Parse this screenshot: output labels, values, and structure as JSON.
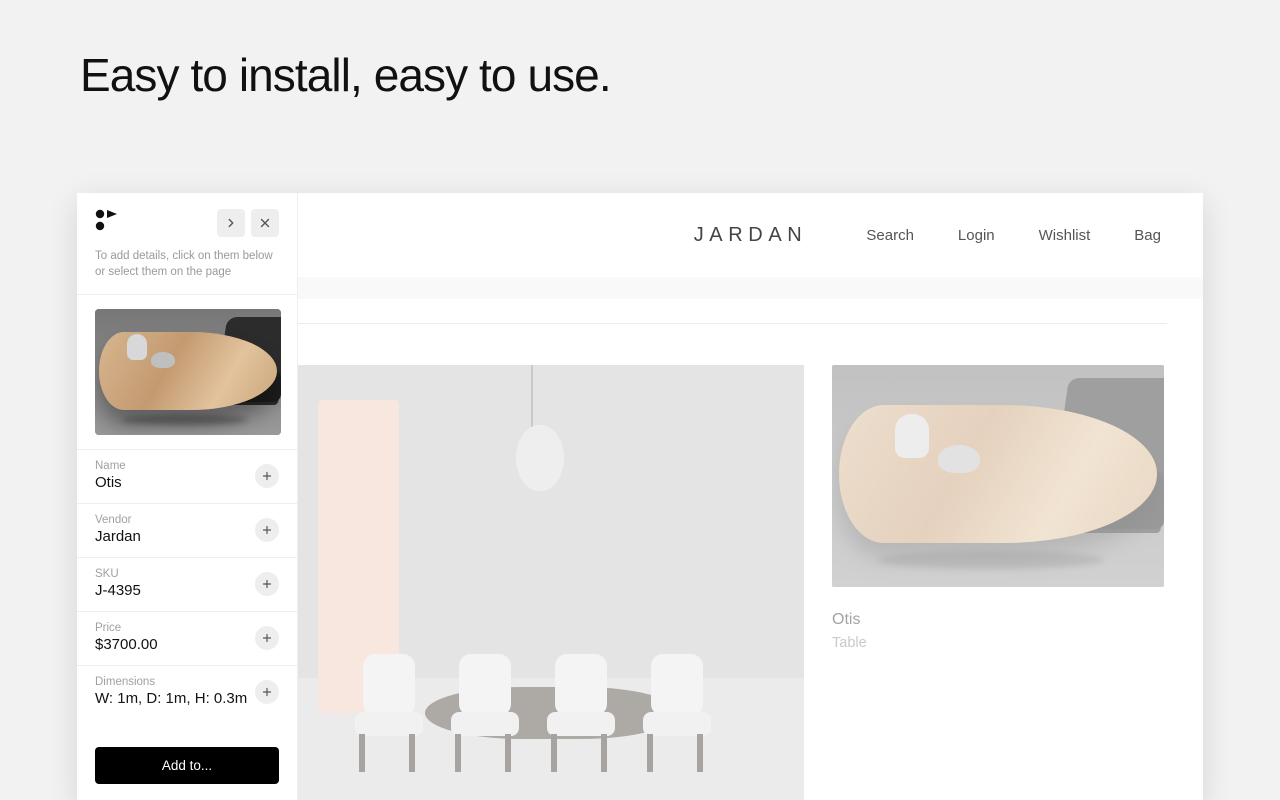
{
  "hero": {
    "title": "Easy to install, easy to use."
  },
  "sidebar": {
    "hint": "To add details, click on them below or select them on the page",
    "fields": [
      {
        "label": "Name",
        "value": "Otis"
      },
      {
        "label": "Vendor",
        "value": "Jardan"
      },
      {
        "label": "SKU",
        "value": "J-4395"
      },
      {
        "label": "Price",
        "value": "$3700.00"
      },
      {
        "label": "Dimensions",
        "value": "W: 1m, D: 1m, H: 0.3m"
      }
    ],
    "cta": "Add to..."
  },
  "page": {
    "brand": "JARDAN",
    "nav": [
      "Search",
      "Login",
      "Wishlist",
      "Bag"
    ],
    "product": {
      "name": "Otis",
      "type": "Table"
    }
  }
}
